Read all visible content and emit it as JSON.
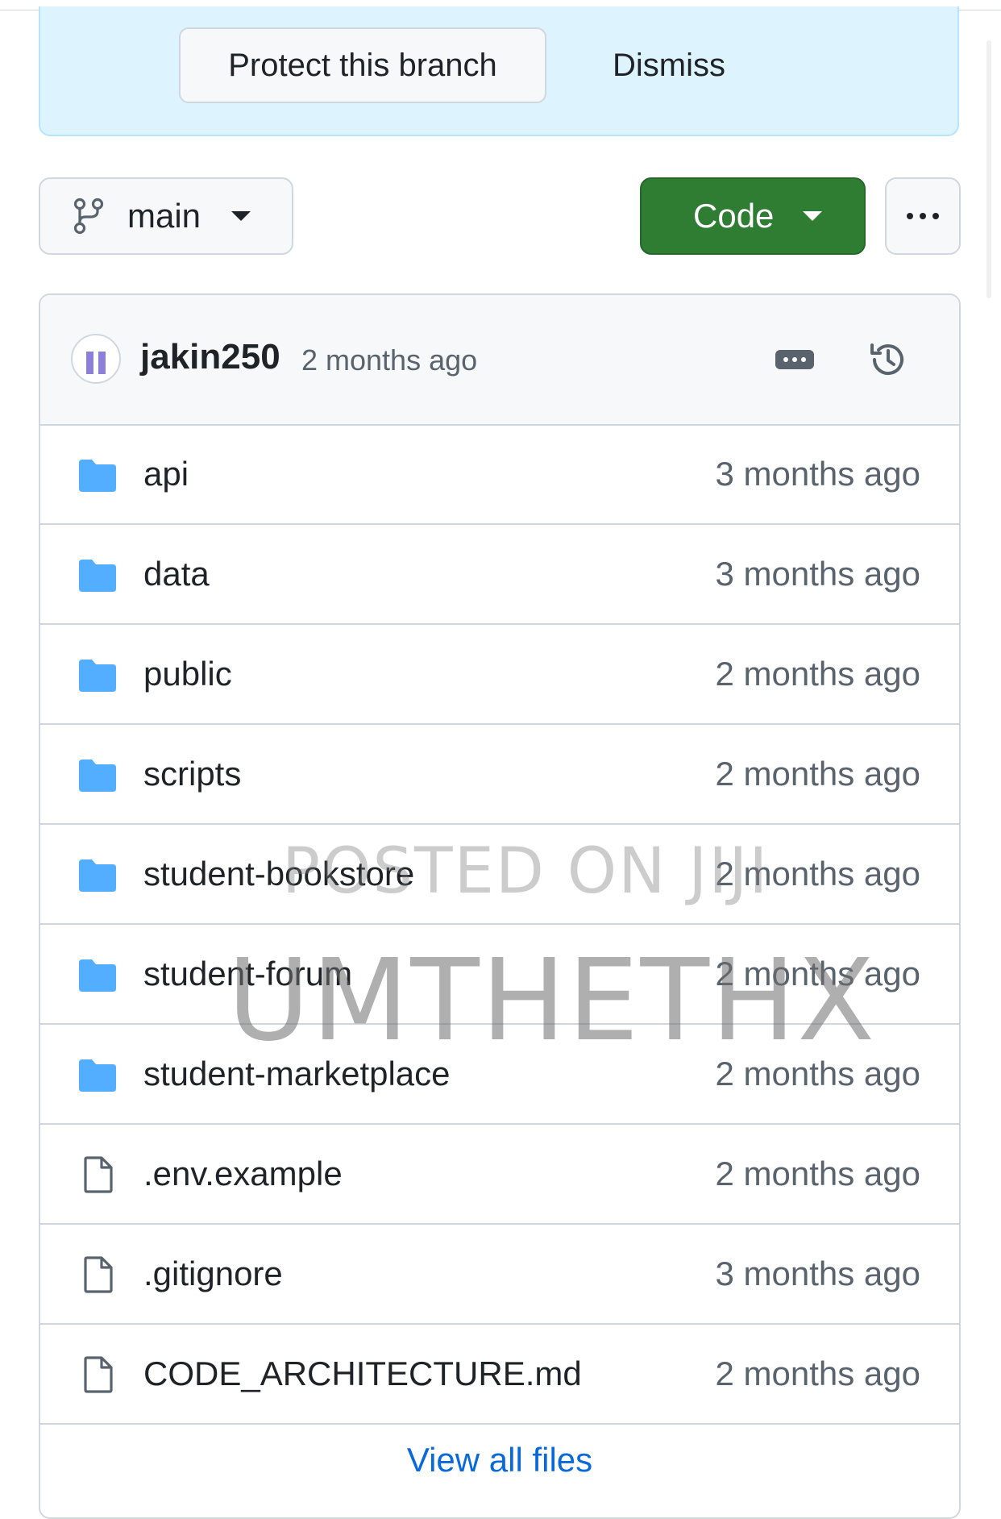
{
  "banner": {
    "protect_label": "Protect this branch",
    "dismiss_label": "Dismiss"
  },
  "toolbar": {
    "branch_label": "main",
    "code_label": "Code"
  },
  "commit": {
    "author": "jakin250",
    "time": "2 months ago"
  },
  "files": [
    {
      "name": "api",
      "time": "3 months ago",
      "icon": "folder-icon"
    },
    {
      "name": "data",
      "time": "3 months ago",
      "icon": "folder-icon"
    },
    {
      "name": "public",
      "time": "2 months ago",
      "icon": "folder-icon"
    },
    {
      "name": "scripts",
      "time": "2 months ago",
      "icon": "folder-icon"
    },
    {
      "name": "student-bookstore",
      "time": "2 months ago",
      "icon": "folder-icon"
    },
    {
      "name": "student-forum",
      "time": "2 months ago",
      "icon": "folder-icon"
    },
    {
      "name": "student-marketplace",
      "time": "2 months ago",
      "icon": "folder-icon"
    },
    {
      "name": ".env.example",
      "time": "2 months ago",
      "icon": "file-icon"
    },
    {
      "name": ".gitignore",
      "time": "3 months ago",
      "icon": "file-icon"
    },
    {
      "name": "CODE_ARCHITECTURE.md",
      "time": "2 months ago",
      "icon": "file-icon"
    }
  ],
  "view_all_label": "View all files",
  "watermark": {
    "line1": "POSTED ON JIJI",
    "line2": "UMTHETHX"
  },
  "colors": {
    "banner_bg": "#ddf4ff",
    "code_button": "#2f7d32",
    "folder": "#54aeff",
    "link": "#0969da",
    "muted_text": "#59636e"
  }
}
